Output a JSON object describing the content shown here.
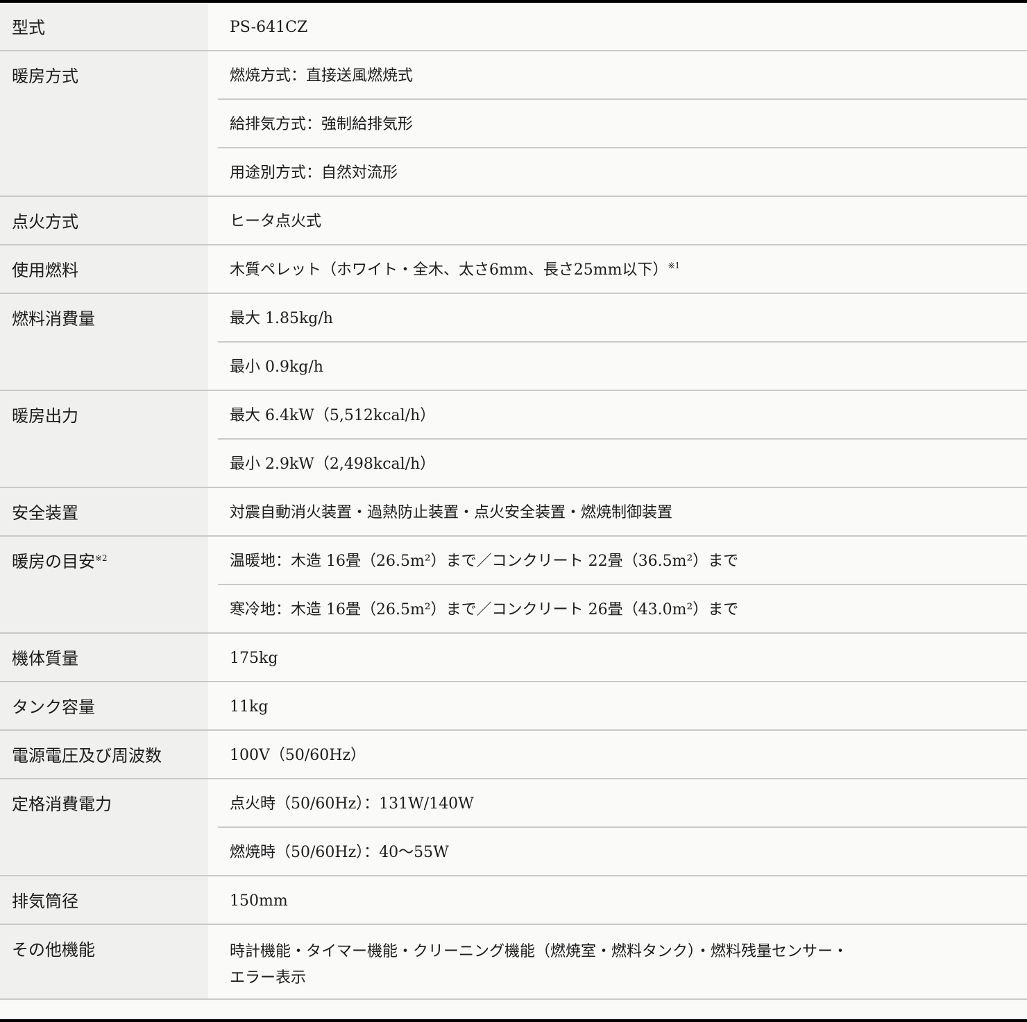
{
  "rows": [
    {
      "label": "型式",
      "values": [
        "PS-641CZ"
      ]
    },
    {
      "label": "暖房方式",
      "values": [
        "燃焼方式：直接送風燃焼式",
        "給排気方式：強制給排気形",
        "用途別方式：自然対流形"
      ]
    },
    {
      "label": "点火方式",
      "values": [
        "ヒータ点火式"
      ]
    },
    {
      "label": "使用燃料",
      "values": [
        "木質ペレット（ホワイト・全木、太さ6mm、長さ25mm以下）"
      ],
      "value_note": "※1"
    },
    {
      "label": "燃料消費量",
      "values": [
        "最大 1.85kg/h",
        "最小 0.9kg/h"
      ]
    },
    {
      "label": "暖房出力",
      "values": [
        "最大 6.4kW（5,512kcal/h）",
        "最小 2.9kW（2,498kcal/h）"
      ]
    },
    {
      "label": "安全装置",
      "values": [
        "対震自動消火装置・過熱防止装置・点火安全装置・燃焼制御装置"
      ]
    },
    {
      "label": "暖房の目安",
      "label_note": "※2",
      "values": [
        "温暖地：木造 16畳（26.5m²）まで／コンクリート 22畳（36.5m²）まで",
        "寒冷地：木造 16畳（26.5m²）まで／コンクリート 26畳（43.0m²）まで"
      ]
    },
    {
      "label": "機体質量",
      "values": [
        "175kg"
      ]
    },
    {
      "label": "タンク容量",
      "values": [
        "11kg"
      ]
    },
    {
      "label": "電源電圧及び周波数",
      "values": [
        "100V（50/60Hz）"
      ]
    },
    {
      "label": "定格消費電力",
      "values": [
        "点火時（50/60Hz）：131W/140W",
        "燃焼時（50/60Hz）：40〜55W"
      ]
    },
    {
      "label": "排気筒径",
      "values": [
        "150mm"
      ]
    },
    {
      "label": "その他機能",
      "values_multiline": [
        "時計機能・タイマー機能・クリーニング機能（燃焼室・燃料タンク）・燃料残量センサー・",
        "エラー表示"
      ]
    }
  ]
}
